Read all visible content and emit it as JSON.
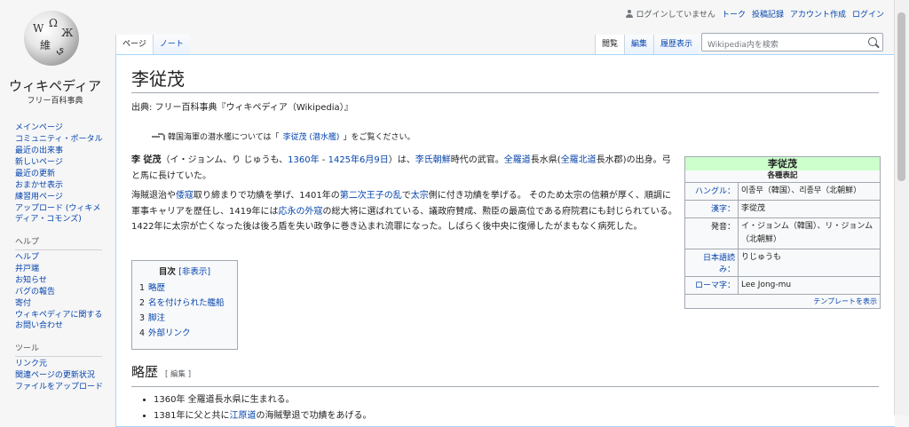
{
  "logo": {
    "wordmark": "ウィキペディア",
    "tagline": "フリー百科事典",
    "glyphs": [
      "W",
      "Ω",
      "Ж",
      "維",
      "ي"
    ]
  },
  "sidebar": {
    "main": [
      "メインページ",
      "コミュニティ・ポータル",
      "最近の出来事",
      "新しいページ",
      "最近の更新",
      "おまかせ表示",
      "練習用ページ",
      "アップロード (ウィキメディア・コモンズ)"
    ],
    "help_heading": "ヘルプ",
    "help": [
      "ヘルプ",
      "井戸端",
      "お知らせ",
      "バグの報告",
      "寄付",
      "ウィキペディアに関するお問い合わせ"
    ],
    "tools_heading": "ツール",
    "tools": [
      "リンク元",
      "関連ページの更新状況",
      "ファイルをアップロード"
    ]
  },
  "personal": {
    "anon": "ログインしていません",
    "links": [
      "トーク",
      "投稿記録",
      "アカウント作成",
      "ログイン"
    ]
  },
  "left_tabs": [
    "ページ",
    "ノート"
  ],
  "right_tabs": [
    "閲覧",
    "編集",
    "履歴表示"
  ],
  "search": {
    "placeholder": "Wikipedia内を検索",
    "icon": "search-icon"
  },
  "article": {
    "title": "李従茂",
    "site_sub": "出典: フリー百科事典『ウィキペディア（Wikipedia）』",
    "hatnote": {
      "prefix": "韓国海軍の潜水艦については「",
      "link": "李従茂 (潜水艦)",
      "suffix": "」をご覧ください。",
      "icon": "disambiguation-icon"
    },
    "p1": {
      "bold": "李 従茂",
      "t1": "（イ・ジョンム、り じゅうも、",
      "l1": "1360年",
      "t2": " - ",
      "l2": "1425年6月9日",
      "t3": "）は、",
      "l3": "李氏朝鮮",
      "t4": "時代の武官。",
      "l4": "全羅道",
      "t5": "長水県(",
      "l5": "全羅北道",
      "t6": "長水郡)の出身。弓と馬に長けていた。"
    },
    "p2": {
      "t1": "海賊退治や",
      "l1": "倭寇",
      "t2": "取り締まりで功績を挙げ、1401年の",
      "l2": "第二次王子の乱",
      "t3": "で",
      "l3": "太宗",
      "t4": "側に付き功績を挙げる。 そのため太宗の信頼が厚く、順調に軍事キャリアを歴任し、1419年には",
      "l4": "応永の外寇",
      "t5": "の総大将に選ばれている、議政府賛成、勲臣の最高位である府院君にも封じられている。1422年に太宗が亡くなった後は後ろ盾を失い政争に巻き込まれ流罪になった。しばらく後中央に復帰したがまもなく病死した。"
    }
  },
  "infobox": {
    "title": "李従茂",
    "subtitle": "各種表記",
    "rows": [
      {
        "label": "ハングル：",
        "value": "이종무（韓国）、리종무（北朝鮮）"
      },
      {
        "label": "漢字：",
        "value": "李從茂"
      },
      {
        "label": "発音：",
        "value": "イ・ジョンム（韓国）、リ・ジョンム（北朝鮮）"
      },
      {
        "label": "日本語読み：",
        "value": "りじゅうも"
      },
      {
        "label": "ローマ字：",
        "value": "Lee Jong-mu"
      }
    ],
    "footer": "テンプレートを表示"
  },
  "toc": {
    "title": "目次",
    "toggle": "[非表示]",
    "items": [
      {
        "num": "1",
        "text": "略歴"
      },
      {
        "num": "2",
        "text": "名を付けられた艦船"
      },
      {
        "num": "3",
        "text": "脚注"
      },
      {
        "num": "4",
        "text": "外部リンク"
      }
    ]
  },
  "section": {
    "heading": "略歴",
    "edit": "[ 編集 ]",
    "items": [
      {
        "text": "1360年 全羅道長水県に生まれる。"
      },
      {
        "t1": "1381年に父と共に",
        "link": "江原道",
        "t2": "の海賊撃退で功績をあげる。"
      }
    ]
  }
}
